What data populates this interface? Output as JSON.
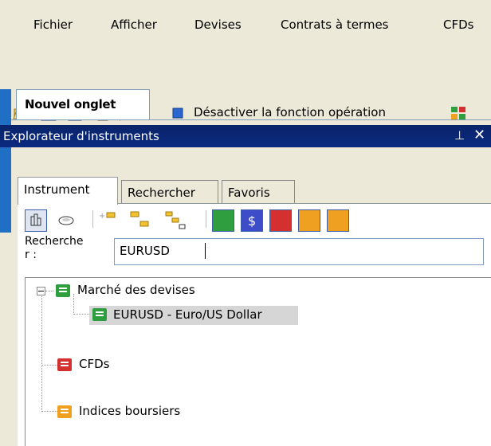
{
  "menu": {
    "items": [
      "Fichier",
      "Afficher",
      "Devises",
      "Contrats à termes",
      "CFDs"
    ]
  },
  "toolbar": {
    "icons": [
      "open-folder-icon",
      "save-icon",
      "save-all-icon",
      "print-icon",
      "stop-icon",
      "palette-icon"
    ],
    "toggle_label": "Désactiver la fonction opération"
  },
  "document_tab": {
    "label": "Nouvel onglet"
  },
  "explorer": {
    "title": "Explorateur d'instruments",
    "tabs": [
      "Instrument",
      "Rechercher",
      "Favoris"
    ],
    "active_tab": "Instrument",
    "search": {
      "label": "Recherche\nr :",
      "value": "EURUSD"
    },
    "tree": {
      "root": {
        "label": "Marché des devises",
        "expanded": true
      },
      "child": {
        "label": "EURUSD - Euro/US Dollar",
        "selected": true
      },
      "node2": {
        "label": "CFDs"
      },
      "node3": {
        "label": "Indices boursiers"
      }
    }
  },
  "colors": {
    "accent_blue": "#1F6FC4",
    "title_bar": "#0a246a",
    "fx_green": "#2E9E3E",
    "cfd_red": "#D43030",
    "index_orange": "#F0A020"
  }
}
